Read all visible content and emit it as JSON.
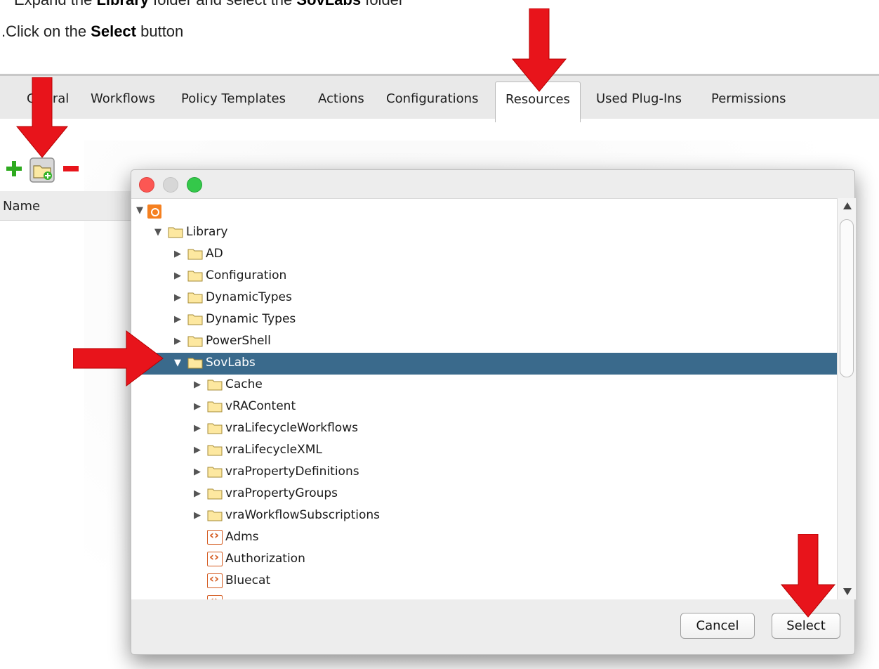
{
  "instructions": {
    "line1_prefix": "Expand the ",
    "line1_bold1": "Library",
    "line1_mid": " folder and select the ",
    "line1_bold2": "SovLabs",
    "line1_suffix": " folder",
    "line2_prefix": ".Click on the ",
    "line2_bold": "Select",
    "line2_suffix": " button"
  },
  "tabs": [
    {
      "label": "G    ral"
    },
    {
      "label": "Workflows"
    },
    {
      "label": "Policy Templates"
    },
    {
      "label": "Actions"
    },
    {
      "label": "Configurations"
    },
    {
      "label": "Resources",
      "active": true
    },
    {
      "label": "Used Plug-Ins"
    },
    {
      "label": "Permissions"
    }
  ],
  "table": {
    "name_header": "Name"
  },
  "tree": {
    "items": [
      {
        "label": "",
        "type": "root",
        "expanded": true
      },
      {
        "label": "Library",
        "type": "folder",
        "expanded": true
      },
      {
        "label": "AD",
        "type": "folder",
        "expanded": false
      },
      {
        "label": "Configuration",
        "type": "folder",
        "expanded": false
      },
      {
        "label": "DynamicTypes",
        "type": "folder",
        "expanded": false
      },
      {
        "label": "Dynamic Types",
        "type": "folder",
        "expanded": false
      },
      {
        "label": "PowerShell",
        "type": "folder",
        "expanded": false
      },
      {
        "label": "SovLabs",
        "type": "folder",
        "expanded": true,
        "selected": true
      },
      {
        "label": "Cache",
        "type": "folder",
        "expanded": false
      },
      {
        "label": "vRAContent",
        "type": "folder",
        "expanded": false
      },
      {
        "label": "vraLifecycleWorkflows",
        "type": "folder",
        "expanded": false
      },
      {
        "label": "vraLifecycleXML",
        "type": "folder",
        "expanded": false
      },
      {
        "label": "vraPropertyDefinitions",
        "type": "folder",
        "expanded": false
      },
      {
        "label": "vraPropertyGroups",
        "type": "folder",
        "expanded": false
      },
      {
        "label": "vraWorkflowSubscriptions",
        "type": "folder",
        "expanded": false
      },
      {
        "label": "Adms",
        "type": "action"
      },
      {
        "label": "Authorization",
        "type": "action"
      },
      {
        "label": "Bluecat",
        "type": "action"
      }
    ]
  },
  "dialog": {
    "cancel_label": "Cancel",
    "select_label": "Select"
  },
  "colors": {
    "selection": "#3a6a8c",
    "arrow_red": "#e8141b",
    "folder_fill": "#fde8a0",
    "action_orange": "#d45b20"
  }
}
